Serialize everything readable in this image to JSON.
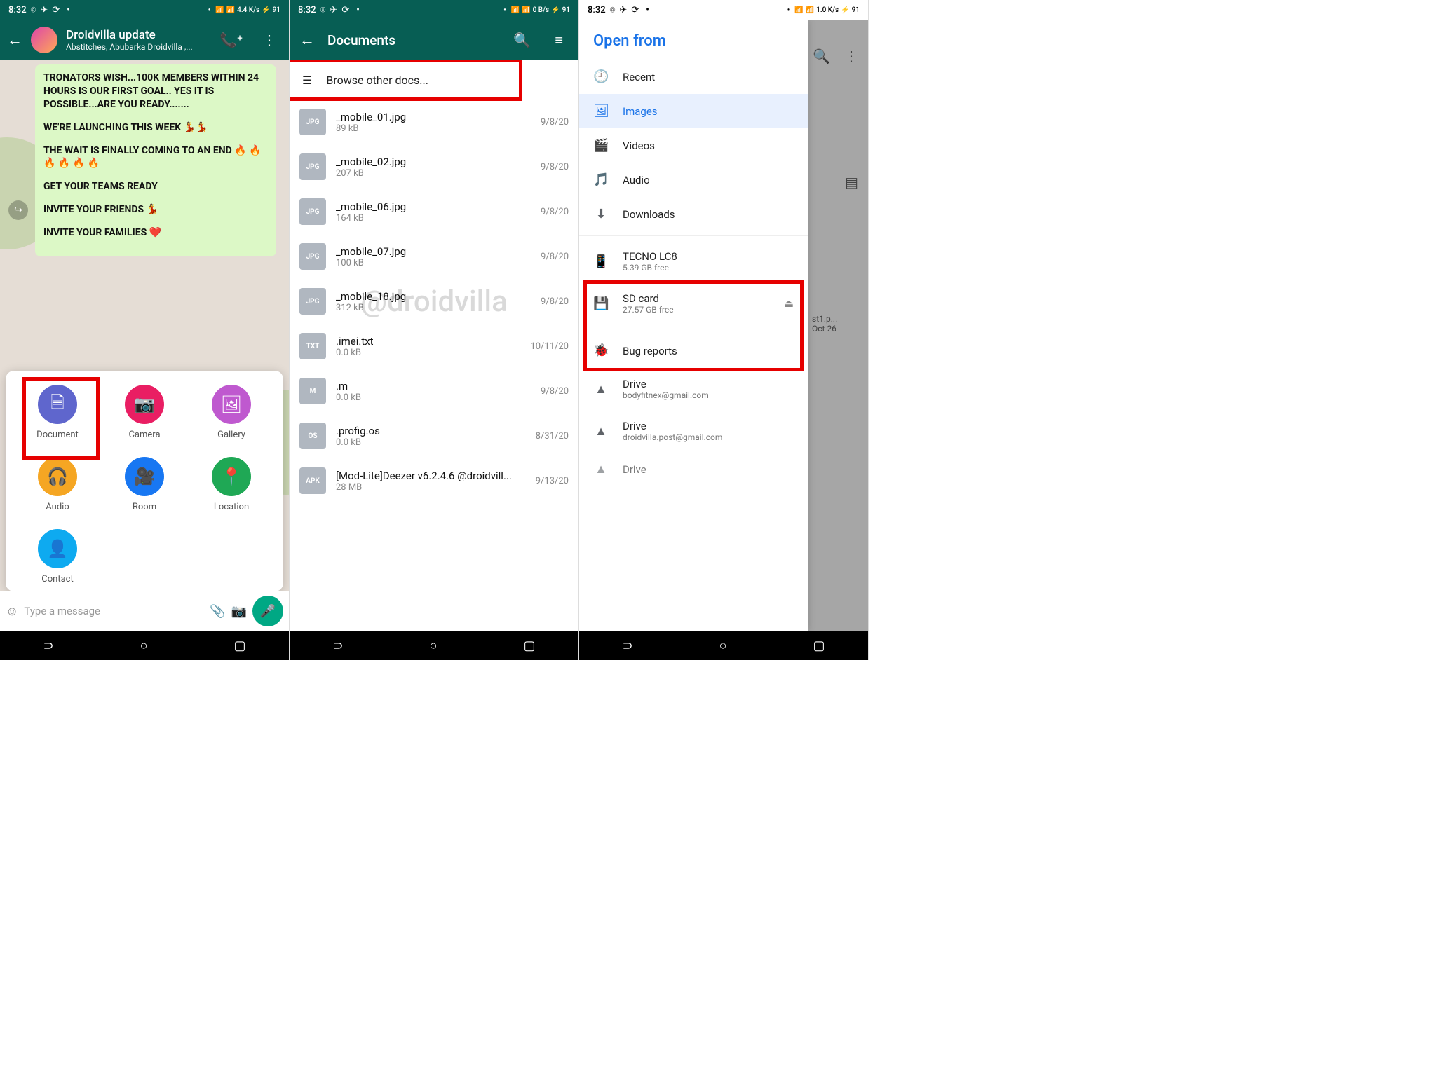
{
  "status": {
    "time": "8:32",
    "net1": "4.4 K/s",
    "net2": "0 B/s",
    "net3": "1.0 K/s",
    "batt": "91"
  },
  "screen1": {
    "chat_title": "Droidvilla update",
    "chat_subtitle": "Abstitches, Abubarka Droidvilla ,...",
    "msg_p1": "TRONATORS WISH...100K MEMBERS WITHIN 24 HOURS IS OUR FIRST GOAL.. YES IT IS POSSIBLE...ARE YOU READY.......",
    "msg_p2": "WE'RE LAUNCHING THIS WEEK 💃💃",
    "msg_p3": "THE WAIT IS FINALLY COMING TO AN END 🔥 🔥 🔥 🔥 🔥 🔥",
    "msg_p4": "GET YOUR TEAMS READY",
    "msg_p5": "INVITE YOUR FRIENDS 💃",
    "msg_p6": "INVITE YOUR FAMILIES ❤️",
    "input_placeholder": "Type a message",
    "attach": [
      {
        "label": "Document"
      },
      {
        "label": "Camera"
      },
      {
        "label": "Gallery"
      },
      {
        "label": "Audio"
      },
      {
        "label": "Room"
      },
      {
        "label": "Location"
      },
      {
        "label": "Contact"
      }
    ]
  },
  "screen2": {
    "title": "Documents",
    "browse": "Browse other docs...",
    "watermark": "@droidvilla",
    "files": [
      {
        "badge": "JPG",
        "name": "_mobile_01.jpg",
        "size": "89 kB",
        "date": "9/8/20"
      },
      {
        "badge": "JPG",
        "name": "_mobile_02.jpg",
        "size": "207 kB",
        "date": "9/8/20"
      },
      {
        "badge": "JPG",
        "name": "_mobile_06.jpg",
        "size": "164 kB",
        "date": "9/8/20"
      },
      {
        "badge": "JPG",
        "name": "_mobile_07.jpg",
        "size": "100 kB",
        "date": "9/8/20"
      },
      {
        "badge": "JPG",
        "name": "_mobile_18.jpg",
        "size": "312 kB",
        "date": "9/8/20"
      },
      {
        "badge": "TXT",
        "name": ".imei.txt",
        "size": "0.0 kB",
        "date": "10/11/20"
      },
      {
        "badge": "M",
        "name": ".m",
        "size": "0.0 kB",
        "date": "9/8/20"
      },
      {
        "badge": "OS",
        "name": ".profig.os",
        "size": "0.0 kB",
        "date": "8/31/20"
      },
      {
        "badge": "APK",
        "name": "[Mod-Lite]Deezer v6.2.4.6 @droidvill...",
        "size": "28 MB",
        "date": "9/13/20"
      }
    ]
  },
  "screen3": {
    "title": "Open from",
    "items": [
      {
        "label": "Recent"
      },
      {
        "label": "Images"
      },
      {
        "label": "Videos"
      },
      {
        "label": "Audio"
      },
      {
        "label": "Downloads"
      }
    ],
    "storage": [
      {
        "label": "TECNO LC8",
        "sub": "5.39 GB free"
      },
      {
        "label": "SD card",
        "sub": "27.57 GB free"
      }
    ],
    "bug": "Bug reports",
    "drives": [
      {
        "label": "Drive",
        "sub": "bodyfitnex@gmail.com"
      },
      {
        "label": "Drive",
        "sub": "droidvilla.post@gmail.com"
      },
      {
        "label": "Drive",
        "sub": ""
      }
    ],
    "bg_file": "st1.p...",
    "bg_date": "Oct 26"
  }
}
